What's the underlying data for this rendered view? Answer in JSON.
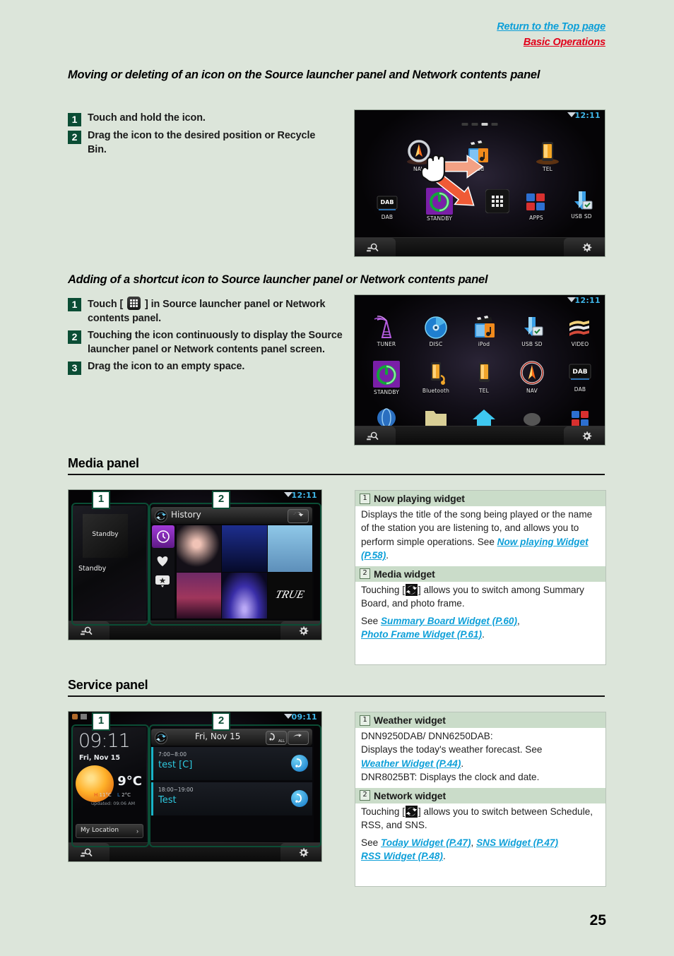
{
  "topnav": {
    "return_link": "Return to the Top page",
    "basic_link": "Basic Operations"
  },
  "sections": [
    {
      "id": "moving-deleting",
      "heading": "Moving or deleting of an icon on the Source launcher panel and Network contents panel",
      "steps": [
        {
          "num": "1",
          "text": "Touch and hold the icon."
        },
        {
          "num": "2",
          "text": "Drag the icon to the desired position or Recycle Bin."
        }
      ],
      "screenshot": {
        "status_time": "12:11",
        "row1": [
          {
            "label": "NAV",
            "icon": "nav-icon"
          },
          {
            "label": "iPod",
            "icon": "ipod-icon"
          },
          {
            "label": "TEL",
            "icon": "tel-icon"
          }
        ],
        "row2": [
          {
            "label": "DAB",
            "icon": "dab-icon"
          },
          {
            "label": "STANDBY",
            "icon": "standby-icon"
          },
          {
            "label": "",
            "icon": "apps-grid-icon"
          },
          {
            "label": "APPS",
            "icon": "apps-icon"
          },
          {
            "label": "USB SD",
            "icon": "usbsd-icon"
          }
        ]
      }
    },
    {
      "id": "adding-shortcut",
      "heading": "Adding of a shortcut icon to Source launcher panel or Network contents panel",
      "steps": [
        {
          "num": "1",
          "text_before": "Touch [",
          "text_after": "] in Source launcher panel or Network contents panel."
        },
        {
          "num": "2",
          "text": "Touching the icon continuously to display the Source launcher panel or Network contents panel screen."
        },
        {
          "num": "3",
          "text": "Drag the icon to an empty space."
        }
      ],
      "screenshot": {
        "status_time": "12:11",
        "row1": [
          {
            "label": "TUNER",
            "icon": "tuner-icon"
          },
          {
            "label": "DISC",
            "icon": "disc-icon"
          },
          {
            "label": "iPod",
            "icon": "ipod-icon"
          },
          {
            "label": "USB SD",
            "icon": "usbsd-icon"
          },
          {
            "label": "VIDEO",
            "icon": "video-icon"
          }
        ],
        "row2": [
          {
            "label": "STANDBY",
            "icon": "standby-icon"
          },
          {
            "label": "Bluetooth",
            "icon": "bluetooth-icon"
          },
          {
            "label": "TEL",
            "icon": "tel-icon"
          },
          {
            "label": "NAV",
            "icon": "nav-icon"
          },
          {
            "label": "DAB",
            "icon": "dab-icon"
          }
        ]
      }
    }
  ],
  "media_panel": {
    "title": "Media panel",
    "screenshot": {
      "status_time": "12:11",
      "callout_1": "1",
      "callout_2": "2",
      "now_playing": {
        "art_label": "Standby",
        "title": "Standby"
      },
      "media_widget": {
        "header_title": "History"
      }
    },
    "descriptions": [
      {
        "num": "1",
        "title": "Now playing widget",
        "body_before": "Displays the title of the song being played or the name of the station you are listening to, and allows you to perform simple operations. See ",
        "links": [
          {
            "text": "Now playing Widget (P.58)"
          }
        ],
        "body_after": "."
      },
      {
        "num": "2",
        "title": "Media widget",
        "body_before": "Touching [",
        "body_mid": "] allows you to switch among Summary Board, and photo frame.",
        "see_label": "See ",
        "links": [
          {
            "text": "Summary Board Widget (P.60)"
          },
          {
            "text": "Photo Frame Widget (P.61)"
          }
        ],
        "body_after": "."
      }
    ]
  },
  "service_panel": {
    "title": "Service panel",
    "screenshot": {
      "status_time": "09:11",
      "callout_1": "1",
      "callout_2": "2",
      "weather": {
        "clock": "09:11",
        "date": "Fri, Nov 15",
        "temp": "9°C",
        "high": "11°C",
        "high_label": "H",
        "low": "2°C",
        "low_label": "L",
        "updated": "updated: 09:06 AM",
        "location": "My Location"
      },
      "network": {
        "header_title": "Fri, Nov 15",
        "btn_all": "ALL",
        "items": [
          {
            "time": "7:00~8:00",
            "title": "test [C]"
          },
          {
            "time": "18:00~19:00",
            "title": "Test"
          }
        ]
      }
    },
    "descriptions": [
      {
        "num": "1",
        "title": "Weather widget",
        "line1": "DNN9250DAB/ DNN6250DAB:",
        "line2": "Displays the today's weather forecast. See ",
        "links": [
          {
            "text": "Weather Widget (P.44)"
          }
        ],
        "line3": "DNR8025BT: Displays the clock and date."
      },
      {
        "num": "2",
        "title": "Network widget",
        "body_before": "Touching [",
        "body_mid": "] allows you to switch between Schedule, RSS, and SNS.",
        "see_label": "See ",
        "links": [
          {
            "text": "Today Widget (P.47)"
          },
          {
            "text": "SNS Widget (P.47)"
          },
          {
            "text": "RSS Widget (P.48)"
          }
        ],
        "body_after": "."
      }
    ]
  },
  "page_number": "25",
  "colors": {
    "background": "#dce5da",
    "badge_green": "#0b4d35",
    "link_blue": "#0d9fd8",
    "link_red": "#e2001a",
    "header_band": "#cadcc9"
  }
}
